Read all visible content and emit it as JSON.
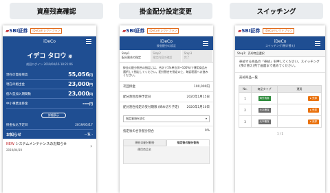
{
  "titles": [
    "資産残高確認",
    "掛金配分設定変更",
    "スイッチング"
  ],
  "brand": {
    "logo": "SBI証券",
    "badge": "iDeCoセレクトプラン"
  },
  "panel1": {
    "header": "iDeCo",
    "user_name": "イデコ タロウ",
    "honorific": "様",
    "last_login": "前回ログイン 2019/04/16 18:21:06",
    "rows": [
      {
        "label": "現在の資産残高",
        "value": "55,056",
        "unit": "円"
      },
      {
        "label": "現在の拠出金",
        "value": "23,000",
        "unit": "円"
      },
      {
        "label": "個人型加入期間数",
        "value": "23,000",
        "unit": "円"
      },
      {
        "label": "中小事業主掛金",
        "value": "---",
        "unit": "円"
      }
    ],
    "detail_button": "詳細表示",
    "date_label": "掛金払込予定日",
    "date_value": "2019/05/17",
    "notice_title": "お知らせ",
    "notice_all": "一覧",
    "notice_new": "NEW",
    "notice_text": "システムメンテナンスのお知らせ",
    "notice_date": "2019/04/19"
  },
  "panel2": {
    "header": "iDeCo",
    "sub_header": "掛金配分の設定",
    "steps": [
      {
        "step": "Step1",
        "label": "配分割合の指定"
      },
      {
        "step": "Step2",
        "label": "指定内容の確認"
      },
      {
        "step": "Step3",
        "label": "完了"
      }
    ],
    "paragraph": "掛金の配分割合の指定には、合計で1%単位(0~100%)で運用商品を選択して指定してください。配分割合を指定の上、確認画面へお進みください。",
    "kv": [
      {
        "label": "次回掛金",
        "value": "100,000円"
      },
      {
        "label": "配分割合反映予定日",
        "value": "2020年1月15日"
      },
      {
        "label": "配分割合指定の受付期限 (締め切り予定)",
        "value": "2020年1月10日"
      }
    ],
    "select_label": "指定事項を読む",
    "total_label": "指定後の合計配分割合",
    "total_value": "0%",
    "tabs": [
      "現在の配分割合",
      "指定後の配分割合"
    ],
    "fund_header": "運用商品名"
  },
  "panel3": {
    "header": "iDeCo",
    "sub_header": "スイッチング(預け替え)",
    "step_label": "Step1：売却商品選択",
    "note": "売却する商品の「売却」を押してください。スイッチング(預け替え)完了画面まで進めてください。",
    "section_title": "売却商品一覧",
    "table_headers": [
      "No.",
      "商品タイプ",
      "運用"
    ],
    "rows": [
      {
        "no": "1",
        "category": "海外債券",
        "category_color": "green",
        "sell": "売却"
      },
      {
        "no": "2",
        "category": "元本確保",
        "category_color": "gray",
        "sell": "売却"
      },
      {
        "no": "3",
        "category": "元本確保",
        "category_color": "gray",
        "sell": "売却"
      }
    ],
    "pager": "1 / 1"
  },
  "colors": {
    "header_blue": "#1f4e92",
    "logo_navy": "#1a3c8c",
    "accent_orange": "#e9720f",
    "category_green": "#2e8b3c"
  }
}
